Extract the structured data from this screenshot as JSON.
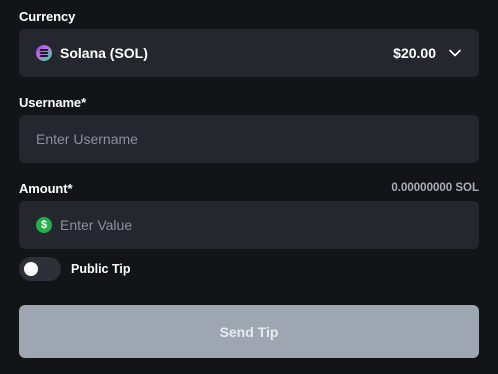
{
  "currency": {
    "label": "Currency",
    "selected_name": "Solana (SOL)",
    "selected_amount": "$20.00",
    "icon": "solana-logo-icon",
    "dropdown_icon": "chevron-down-icon"
  },
  "username": {
    "label": "Username*",
    "placeholder": "Enter Username",
    "value": ""
  },
  "amount": {
    "label": "Amount*",
    "conversion": "0.00000000 SOL",
    "placeholder": "Enter Value",
    "value": "",
    "icon": "dollar-coin-icon",
    "icon_glyph": "$"
  },
  "public_tip": {
    "label": "Public Tip",
    "enabled": false
  },
  "send_button": {
    "label": "Send Tip",
    "disabled": true
  },
  "colors": {
    "background": "#131417",
    "field": "#25272e",
    "button_disabled": "#9ea6b2",
    "dollar_green": "#22b04a"
  }
}
